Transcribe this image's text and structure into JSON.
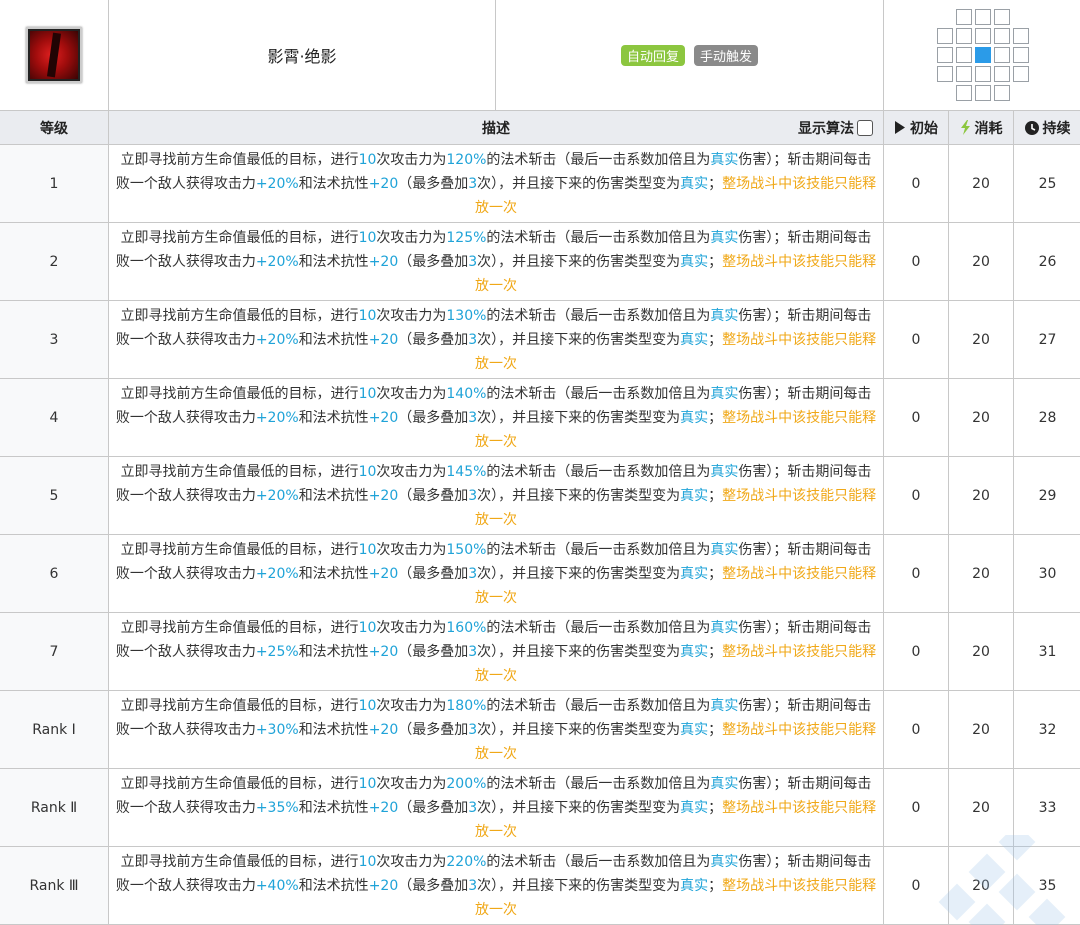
{
  "skill": {
    "name": "影霄·绝影",
    "tags": [
      "自动回复",
      "手动触发"
    ],
    "tag_colors": [
      "#8cc63f",
      "#8a8a8a"
    ],
    "icon": "skill-icon-red-slash"
  },
  "range": {
    "rows": [
      [
        0,
        1,
        1,
        1,
        0
      ],
      [
        1,
        1,
        1,
        1,
        1
      ],
      [
        1,
        1,
        2,
        1,
        1
      ],
      [
        1,
        1,
        1,
        1,
        1
      ],
      [
        0,
        1,
        1,
        1,
        0
      ]
    ]
  },
  "header": {
    "level": "等级",
    "desc": "描述",
    "show_algo": "显示算法",
    "initial": "初始",
    "cost": "消耗",
    "duration": "持续"
  },
  "levels": [
    {
      "lv": "1",
      "pct": "120%",
      "atk": "+20%",
      "init": "0",
      "cost": "20",
      "dur": "25"
    },
    {
      "lv": "2",
      "pct": "125%",
      "atk": "+20%",
      "init": "0",
      "cost": "20",
      "dur": "26"
    },
    {
      "lv": "3",
      "pct": "130%",
      "atk": "+20%",
      "init": "0",
      "cost": "20",
      "dur": "27"
    },
    {
      "lv": "4",
      "pct": "140%",
      "atk": "+20%",
      "init": "0",
      "cost": "20",
      "dur": "28"
    },
    {
      "lv": "5",
      "pct": "145%",
      "atk": "+20%",
      "init": "0",
      "cost": "20",
      "dur": "29"
    },
    {
      "lv": "6",
      "pct": "150%",
      "atk": "+20%",
      "init": "0",
      "cost": "20",
      "dur": "30"
    },
    {
      "lv": "7",
      "pct": "160%",
      "atk": "+25%",
      "init": "0",
      "cost": "20",
      "dur": "31"
    },
    {
      "lv": "Rank Ⅰ",
      "pct": "180%",
      "atk": "+30%",
      "init": "0",
      "cost": "20",
      "dur": "32"
    },
    {
      "lv": "Rank Ⅱ",
      "pct": "200%",
      "atk": "+35%",
      "init": "0",
      "cost": "20",
      "dur": "33"
    },
    {
      "lv": "Rank Ⅲ",
      "pct": "220%",
      "atk": "+40%",
      "init": "0",
      "cost": "20",
      "dur": "35"
    }
  ],
  "desc_parts": {
    "p1": "立即寻找前方生命值最低的目标，进行",
    "hits": "10",
    "p2": "次攻击力为",
    "p3": "的法术斩击（最后一击系数加倍且为",
    "true_dmg": "真实",
    "p4": "伤害）；斩击期间每击败一个敌人获得攻击力",
    "p5": "和法术抗性",
    "res": "+20",
    "p6": "（最多叠加",
    "stacks": "3",
    "p7": "次），并且接下来的伤害类型变为",
    "true2": "真实",
    "p8": "；",
    "gold": "整场战斗中该技能只能释放一次"
  },
  "colors": {
    "accent": "#1fa3d8",
    "gold": "#f0a818",
    "header_bg": "#eaecf0",
    "range_self": "#2b9be8"
  }
}
